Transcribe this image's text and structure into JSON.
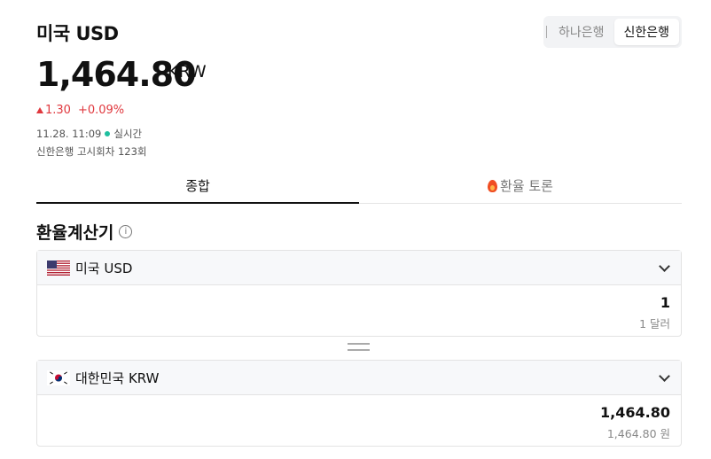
{
  "header": {
    "title": "미국 USD",
    "banks": [
      "하나은행",
      "신한은행"
    ],
    "selected_bank": "신한은행"
  },
  "rate": {
    "value": "1,464.80",
    "unit": "KRW",
    "change": "1.30",
    "change_pct": "+0.09%",
    "timestamp": "11.28. 11:09",
    "live_label": "실시간",
    "notice": "신한은행 고시회차 123회"
  },
  "tabs": [
    "종합",
    "환율 토론"
  ],
  "calculator": {
    "title": "환율계산기",
    "info_glyph": "i",
    "from": {
      "currency": "미국 USD",
      "value": "1",
      "sub": "1 달러"
    },
    "to": {
      "currency": "대한민국 KRW",
      "value": "1,464.80",
      "sub": "1,464.80 원"
    }
  },
  "colors": {
    "up": "#e0383e",
    "live": "#1fbf9f"
  },
  "icons": [
    "chevron-down-icon",
    "info-icon",
    "swap-icon",
    "fire-icon",
    "us-flag-icon",
    "kr-flag-icon"
  ]
}
